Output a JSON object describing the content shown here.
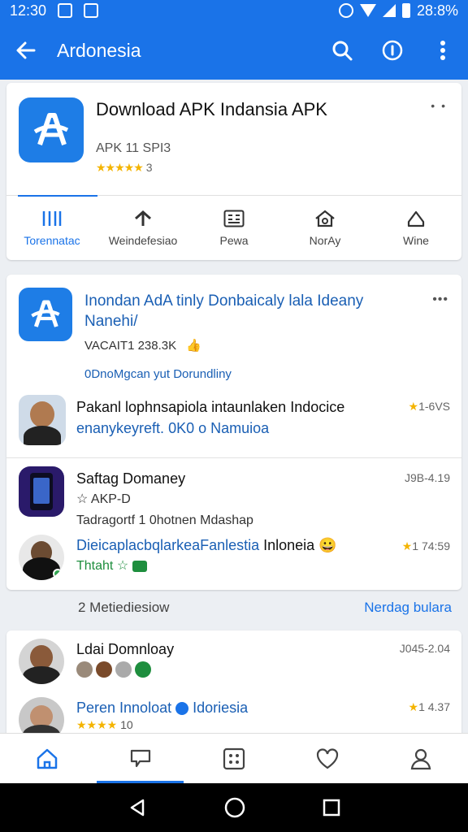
{
  "status_bar": {
    "time": "12:30",
    "battery": "28:8%"
  },
  "app_bar": {
    "title": "Ardonesia"
  },
  "app_header": {
    "name": "Download APK Indansia APK",
    "version": "APK 11 SPI3",
    "stars": "★★★★★",
    "rating_count": "3",
    "more": "• •"
  },
  "tabs": [
    {
      "label": "Torennatac"
    },
    {
      "label": "Weindefesiao"
    },
    {
      "label": "Pewa"
    },
    {
      "label": "NorAy"
    },
    {
      "label": "Wine"
    }
  ],
  "feature": {
    "title": "Inondan AdA tinly Donbaicaly lala Ideany Nanehi/",
    "version": "VACAIT1 238.3K",
    "link": "0DnoMgcan yut Dorundliny",
    "more": "•••"
  },
  "reviews": [
    {
      "text": "Pakanl lophnsapiola intaunlaken Indocice",
      "text_blue": "enanykeyreft. 0K0 o Namuioa",
      "rating": "1-6VS"
    },
    {
      "title": "Saftag Domaney",
      "line2": "AKP-D",
      "line3": "Tadragortf 1 0hotnen Mdashap",
      "rating": "J9B-4.19"
    },
    {
      "text_blue": "DieicaplacbqlarkeaFanlestia",
      "text": "Inloneia",
      "emoji": "😀",
      "sub": "Thtaht",
      "rating": "1 74:59"
    }
  ],
  "section": {
    "left": "2 Metiediesiow",
    "right": "Nerdag bulara"
  },
  "more_reviews": [
    {
      "title": "Ldai Domnloay",
      "rating": "J045-2.04"
    },
    {
      "text_blue": "Peren Innoloat",
      "text_blue2": "Idoriesia",
      "rating_count": "10",
      "rating": "1 4.37"
    }
  ]
}
